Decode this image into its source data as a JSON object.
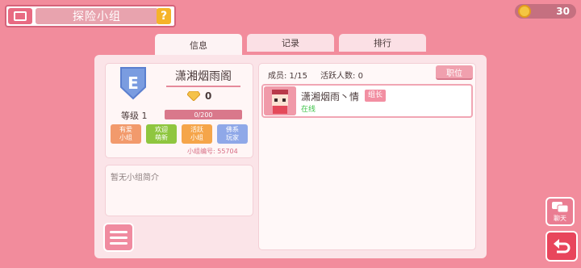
{
  "header": {
    "title": "探险小组",
    "help_label": "?",
    "coins": "30"
  },
  "tabs": [
    {
      "label": "信息",
      "active": true
    },
    {
      "label": "记录",
      "active": false
    },
    {
      "label": "排行",
      "active": false
    }
  ],
  "clan": {
    "emblem_letter": "E",
    "name": "潇湘烟雨阁",
    "gems": "0",
    "level_label": "等级 1",
    "exp_text": "0/200",
    "tags": [
      {
        "text": "有爱\n小组",
        "color": "#f29a6c"
      },
      {
        "text": "欢迎\n萌新",
        "color": "#8fc63f"
      },
      {
        "text": "活跃\n小组",
        "color": "#f5a54a"
      },
      {
        "text": "佛系\n玩家",
        "color": "#8fa8e8"
      }
    ],
    "id_text": "小组编号: 55704",
    "intro": "暂无小组简介"
  },
  "members_panel": {
    "members_count": "成员: 1/15",
    "active_count": "活跃人数: 0",
    "role_button": "职位",
    "members": [
      {
        "name": "潇湘烟雨丶情",
        "badge": "组长",
        "status": "在线"
      }
    ]
  },
  "side": {
    "chat_label": "聊天"
  },
  "colors": {
    "background": "#f28c9c",
    "accent": "#e8465c",
    "online": "#3fc34a"
  }
}
